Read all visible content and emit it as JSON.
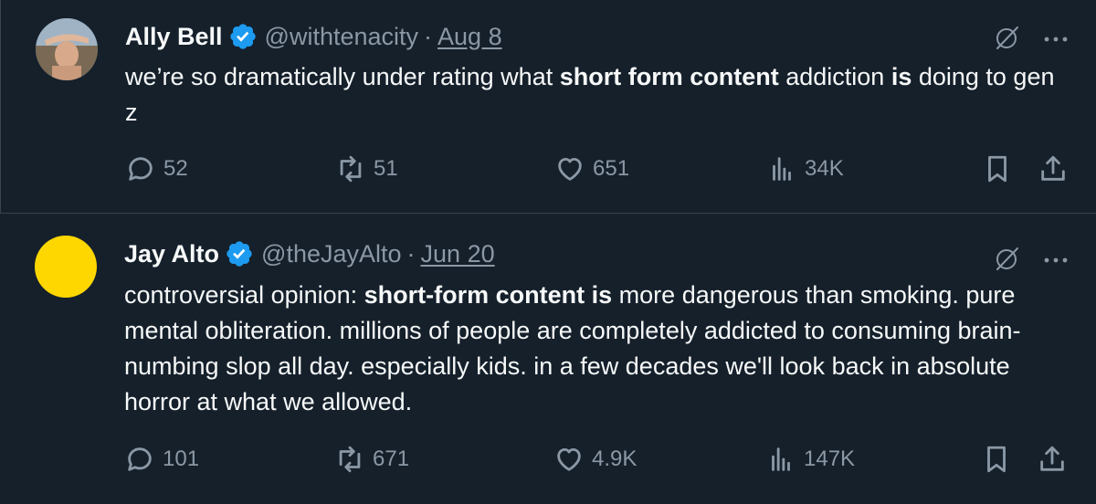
{
  "tweets": [
    {
      "name": "Ally Bell",
      "handle": "@withtenacity",
      "separator": "·",
      "date": "Aug 8",
      "body": [
        {
          "text": "we’re so dramatically under rating what ",
          "bold": false
        },
        {
          "text": "short form content",
          "bold": true
        },
        {
          "text": " addiction ",
          "bold": false
        },
        {
          "text": "is",
          "bold": true
        },
        {
          "text": " doing to gen z",
          "bold": false
        }
      ],
      "stats": {
        "replies": "52",
        "reposts": "51",
        "likes": "651",
        "views": "34K"
      }
    },
    {
      "name": "Jay Alto",
      "handle": "@theJayAlto",
      "separator": "·",
      "date": "Jun 20",
      "body": [
        {
          "text": "controversial opinion: ",
          "bold": false
        },
        {
          "text": "short-form content is",
          "bold": true
        },
        {
          "text": " more dangerous than smoking. pure mental obliteration. millions of people are completely addicted to consuming brain-numbing slop all day. especially kids. in a few decades we'll look back in absolute horror at what we allowed.",
          "bold": false
        }
      ],
      "stats": {
        "replies": "101",
        "reposts": "671",
        "likes": "4.9K",
        "views": "147K"
      }
    }
  ],
  "colors": {
    "background": "#15202b",
    "text": "#f7f9f9",
    "muted": "#8b98a5",
    "verified": "#1d9bf0",
    "avatar2": "#ffd700",
    "divider": "#38444d"
  },
  "icons": [
    "verified-badge-icon",
    "grok-icon",
    "more-icon",
    "reply-icon",
    "repost-icon",
    "like-icon",
    "views-icon",
    "bookmark-icon",
    "share-icon"
  ]
}
